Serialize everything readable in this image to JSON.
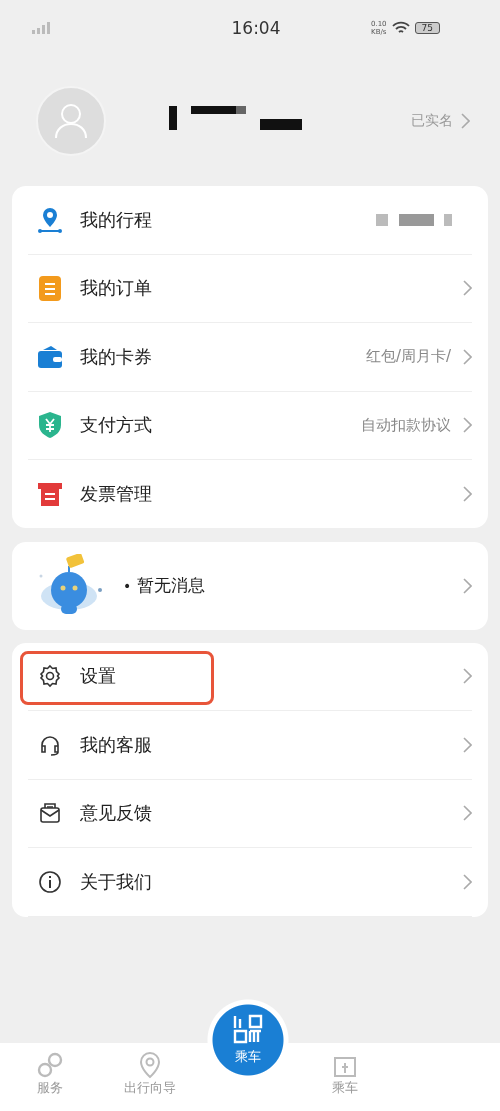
{
  "status_bar": {
    "time": "16:04",
    "net_speed": "0.10",
    "net_unit": "KB/s",
    "battery": "75"
  },
  "profile": {
    "verified": "已实名"
  },
  "menu_main": [
    {
      "label": "我的行程",
      "chevron": false
    },
    {
      "label": "我的订单",
      "chevron": true
    },
    {
      "label": "我的卡券",
      "value": "红包/周月卡/",
      "chevron": true
    },
    {
      "label": "支付方式",
      "value": "自动扣款协议",
      "chevron": true
    },
    {
      "label": "发票管理",
      "chevron": true
    }
  ],
  "messages": {
    "bullet": "•",
    "text": "暂无消息"
  },
  "menu_more": [
    {
      "label": "设置",
      "highlighted": true
    },
    {
      "label": "我的客服",
      "highlighted": false
    },
    {
      "label": "意见反馈",
      "highlighted": false
    },
    {
      "label": "关于我们",
      "highlighted": false
    }
  ],
  "tab_bar": [
    {
      "label": "服务",
      "kind": "tab",
      "selected": false
    },
    {
      "label": "出行向导",
      "kind": "tab",
      "selected": false
    },
    {
      "label": "乘车",
      "kind": "center",
      "selected": false
    },
    {
      "label": "乘车",
      "kind": "tab",
      "selected": false
    }
  ]
}
